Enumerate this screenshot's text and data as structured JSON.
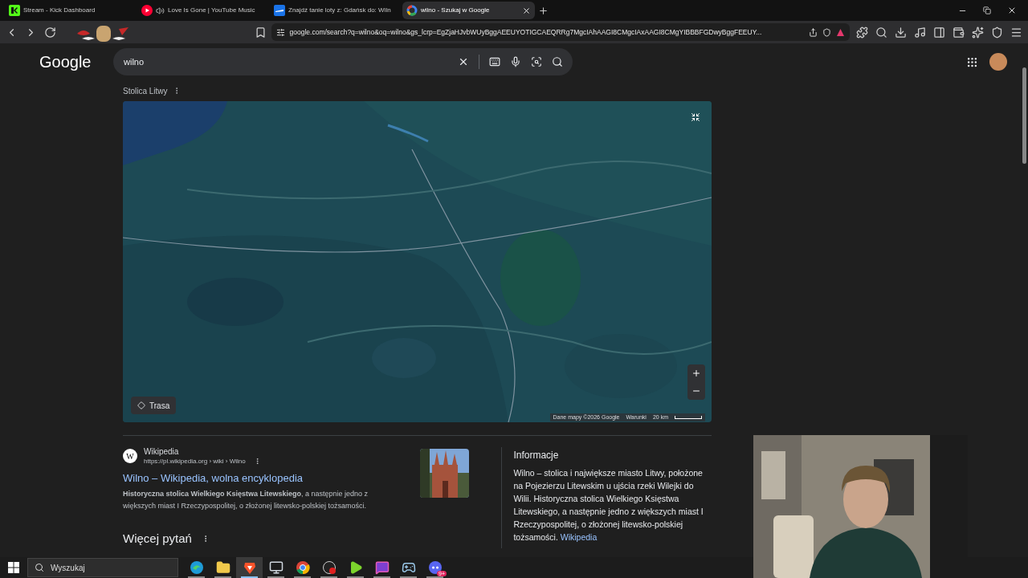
{
  "tabs": [
    {
      "kind": "kick",
      "title": "Stream - Kick Dashboard",
      "selected": false,
      "audio": false
    },
    {
      "kind": "youtube",
      "title": "Love Is Gone | YouTube Music",
      "selected": false,
      "audio": true
    },
    {
      "kind": "flights",
      "title": "Znajdź tanie loty z: Gdańsk do: Wiln",
      "selected": false,
      "audio": false
    },
    {
      "kind": "google",
      "title": "wilno - Szukaj w Google",
      "selected": true,
      "audio": false
    }
  ],
  "address_bar": {
    "url": "google.com/search?q=wilno&oq=wilno&gs_lcrp=EgZjaHJvbWUyBggAEEUYOTIGCAEQRRg7MgcIAhAAGI8CMgcIAxAAGI8CMgYIBBBFGDwyBggFEEUY..."
  },
  "google": {
    "logo": "Google",
    "query": "wilno"
  },
  "map_section": {
    "title": "Stolica Litwy",
    "route_button": "Trasa",
    "attribution": "Dane mapy ©2026 Google",
    "terms": "Warunki",
    "scale": "20 km"
  },
  "result": {
    "favicon": "W",
    "site": "Wikipedia",
    "breadcrumb": "https://pl.wikipedia.org › wiki › Wilno",
    "title": "Wilno – Wikipedia, wolna encyklopedia",
    "snippet": "**Historyczna stolica Wielkiego Księstwa Litewskiego**, a następnie jedno z większych miast I Rzeczypospolitej, o złożonej litewsko-polskiej tożsamości."
  },
  "more_questions": "Więcej pytań",
  "info_panel": {
    "title": "Informacje",
    "text": "Wilno – stolica i największe miasto Litwy, położone na Pojezierzu Litewskim u ujścia rzeki Wilejki do Wilii. Historyczna stolica Wielkiego Księstwa Litewskiego, a następnie jedno z większych miast I Rzeczypospolitej, o złożonej litewsko-polskiej tożsamości.",
    "link": "Wikipedia"
  },
  "taskbar": {
    "search_placeholder": "Wyszukaj",
    "apps": [
      {
        "kind": "edge",
        "selected": false
      },
      {
        "kind": "folder",
        "selected": false
      },
      {
        "kind": "brave",
        "selected": true
      },
      {
        "kind": "monitor",
        "selected": false
      },
      {
        "kind": "chrome",
        "selected": false
      },
      {
        "kind": "obs",
        "selected": false
      },
      {
        "kind": "play",
        "selected": false
      },
      {
        "kind": "chat",
        "selected": false
      },
      {
        "kind": "steam",
        "selected": false
      },
      {
        "kind": "discord",
        "selected": false,
        "badge": "9+"
      }
    ]
  }
}
